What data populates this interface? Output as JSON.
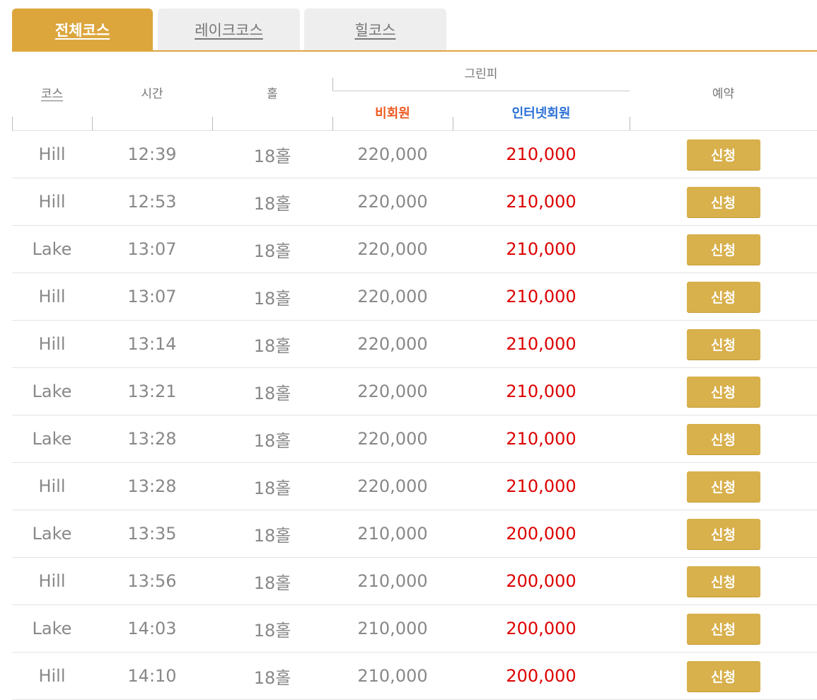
{
  "tabs": [
    {
      "label": "전체코스",
      "active": true
    },
    {
      "label": "레이크코스",
      "active": false
    },
    {
      "label": "힐코스",
      "active": false
    }
  ],
  "headers": {
    "course": "코스",
    "time": "시간",
    "hole": "홀",
    "green_fee": "그린피",
    "non_member": "비회원",
    "internet_member": "인터넷회원",
    "reservation": "예약"
  },
  "rows": [
    {
      "course": "Hill",
      "time": "12:39",
      "hole": "18홀",
      "non_member": "220,000",
      "internet_member": "210,000",
      "button": "신청"
    },
    {
      "course": "Hill",
      "time": "12:53",
      "hole": "18홀",
      "non_member": "220,000",
      "internet_member": "210,000",
      "button": "신청"
    },
    {
      "course": "Lake",
      "time": "13:07",
      "hole": "18홀",
      "non_member": "220,000",
      "internet_member": "210,000",
      "button": "신청"
    },
    {
      "course": "Hill",
      "time": "13:07",
      "hole": "18홀",
      "non_member": "220,000",
      "internet_member": "210,000",
      "button": "신청"
    },
    {
      "course": "Hill",
      "time": "13:14",
      "hole": "18홀",
      "non_member": "220,000",
      "internet_member": "210,000",
      "button": "신청"
    },
    {
      "course": "Lake",
      "time": "13:21",
      "hole": "18홀",
      "non_member": "220,000",
      "internet_member": "210,000",
      "button": "신청"
    },
    {
      "course": "Lake",
      "time": "13:28",
      "hole": "18홀",
      "non_member": "220,000",
      "internet_member": "210,000",
      "button": "신청"
    },
    {
      "course": "Hill",
      "time": "13:28",
      "hole": "18홀",
      "non_member": "220,000",
      "internet_member": "210,000",
      "button": "신청"
    },
    {
      "course": "Lake",
      "time": "13:35",
      "hole": "18홀",
      "non_member": "210,000",
      "internet_member": "200,000",
      "button": "신청"
    },
    {
      "course": "Hill",
      "time": "13:56",
      "hole": "18홀",
      "non_member": "210,000",
      "internet_member": "200,000",
      "button": "신청"
    },
    {
      "course": "Lake",
      "time": "14:03",
      "hole": "18홀",
      "non_member": "210,000",
      "internet_member": "200,000",
      "button": "신청"
    },
    {
      "course": "Hill",
      "time": "14:10",
      "hole": "18홀",
      "non_member": "210,000",
      "internet_member": "200,000",
      "button": "신청"
    }
  ],
  "colors": {
    "accent": "#dca63d",
    "button": "#d8b04c",
    "non_member_header": "#ef5a21",
    "internet_member_header": "#2a6fd6",
    "internet_price": "#dd0000",
    "text": "#888888"
  }
}
